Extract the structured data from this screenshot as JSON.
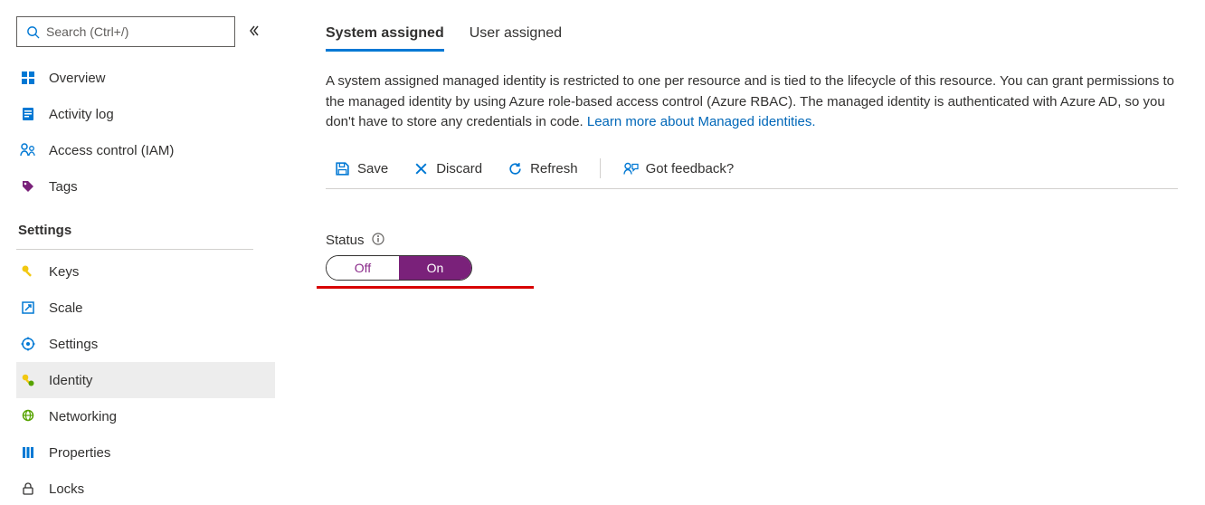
{
  "search": {
    "placeholder": "Search (Ctrl+/)"
  },
  "sidebar": {
    "items_top": [
      {
        "label": "Overview"
      },
      {
        "label": "Activity log"
      },
      {
        "label": "Access control (IAM)"
      },
      {
        "label": "Tags"
      }
    ],
    "section_title": "Settings",
    "items_settings": [
      {
        "label": "Keys"
      },
      {
        "label": "Scale"
      },
      {
        "label": "Settings"
      },
      {
        "label": "Identity"
      },
      {
        "label": "Networking"
      },
      {
        "label": "Properties"
      },
      {
        "label": "Locks"
      }
    ]
  },
  "tabs": {
    "system": "System assigned",
    "user": "User assigned"
  },
  "description_text": "A system assigned managed identity is restricted to one per resource and is tied to the lifecycle of this resource. You can grant permissions to the managed identity by using Azure role-based access control (Azure RBAC). The managed identity is authenticated with Azure AD, so you don't have to store any credentials in code. ",
  "description_link": "Learn more about Managed identities.",
  "toolbar": {
    "save": "Save",
    "discard": "Discard",
    "refresh": "Refresh",
    "feedback": "Got feedback?"
  },
  "status": {
    "label": "Status",
    "off": "Off",
    "on": "On"
  }
}
